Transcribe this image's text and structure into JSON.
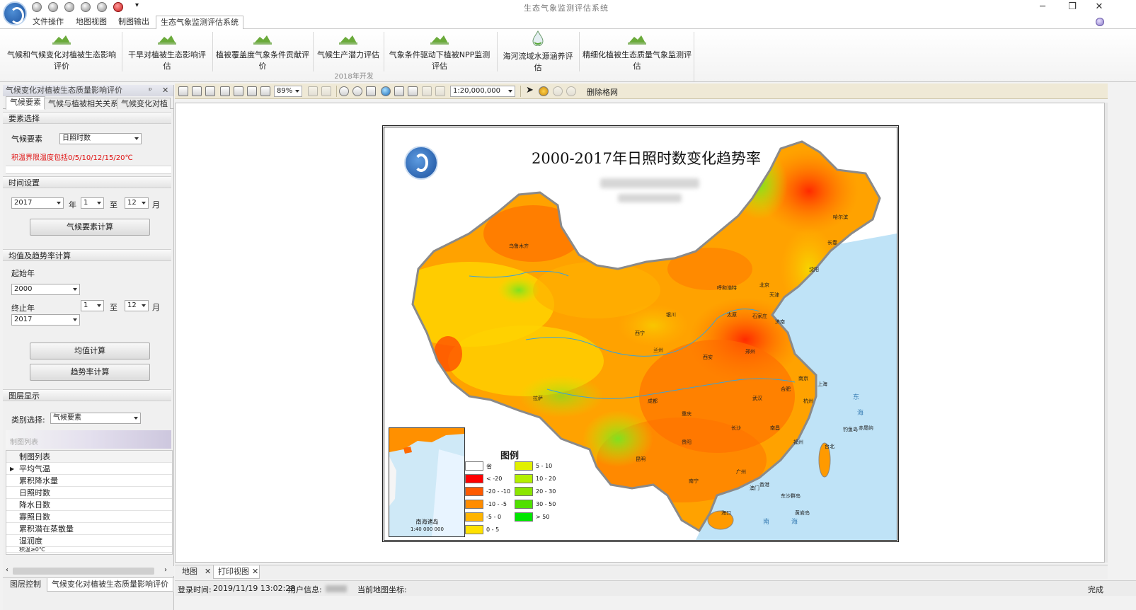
{
  "window": {
    "title": "生态气象监测评估系统",
    "minimize_symbol": "─",
    "maximize_symbol": "❐",
    "close_symbol": "✕"
  },
  "ribbon_tabs": [
    "文件操作",
    "地图视图",
    "制图输出",
    "生态气象监测评估系统"
  ],
  "ribbon_buttons": [
    "气候和气候变化对植被生态影响评价",
    "干旱对植被生态影响评估",
    "植被覆盖度气象条件贡献评价",
    "气候生产潜力评估",
    "气象条件驱动下植被NPP监测评估",
    "海河流域水源涵养评估",
    "精细化植被生态质量气象监测评估"
  ],
  "ribbon_group_label": "2018年开发",
  "left_panel": {
    "title": "气候变化对植被生态质量影响评价",
    "pin_symbol": "ᵖ",
    "close_symbol": "✕",
    "tabs": [
      "气候要素",
      "气候与植被相关关系",
      "气候变化对植"
    ],
    "element_select": {
      "section": "要素选择",
      "label": "气候要素",
      "value": "日照时数",
      "note": "积温界限温度包括0/5/10/12/15/20℃"
    },
    "time_settings": {
      "section": "时间设置",
      "year": "2017",
      "year_unit": "年",
      "month_start": "1",
      "to": "至",
      "month_end": "12",
      "month_unit": "月",
      "calc_button": "气候要素计算"
    },
    "mean_trend": {
      "section": "均值及趋势率计算",
      "start_label": "起始年",
      "start_year": "2000",
      "end_label": "终止年",
      "month_start": "1",
      "to": "至",
      "month_end": "12",
      "month_unit": "月",
      "end_year": "2017",
      "mean_button": "均值计算",
      "trend_button": "趋势率计算"
    },
    "layer_display": {
      "section": "图层显示",
      "category_label": "类别选择:",
      "category_value": "气候要素",
      "list_caption": "制图列表",
      "list_header": "制图列表",
      "items": [
        "平均气温",
        "累积降水量",
        "日照时数",
        "降水日数",
        "寡照日数",
        "累积潜在蒸散量",
        "湿润度",
        "积温≥0℃"
      ]
    },
    "bottom_tabs": [
      "图层控制",
      "气候变化对植被生态质量影响评价"
    ]
  },
  "map_toolbar": {
    "zoom_value": "89%",
    "scale_value": "1:20,000,000",
    "delete_grid_label": "删除格网"
  },
  "map": {
    "title": "2000-2017年日照时数变化趋势率",
    "legend_title": "图例",
    "legend_items": [
      {
        "label": "省",
        "color": "#ffffff"
      },
      {
        "label": "< -20",
        "color": "#ff0000"
      },
      {
        "label": "-20 - -10",
        "color": "#ff5a00"
      },
      {
        "label": "-10 - -5",
        "color": "#ff8c00"
      },
      {
        "label": "-5 - 0",
        "color": "#ffb400"
      },
      {
        "label": "0 - 5",
        "color": "#ffe100"
      },
      {
        "label": "5 - 10",
        "color": "#e1f000"
      },
      {
        "label": "10 - 20",
        "color": "#b4f000"
      },
      {
        "label": "20 - 30",
        "color": "#8ce600"
      },
      {
        "label": "30 - 50",
        "color": "#50e000"
      },
      {
        "label": "> 50",
        "color": "#00e600"
      }
    ],
    "inset_label": "南海诸岛",
    "inset_scale": "1:40 000 000",
    "sea_labels": [
      "东",
      "海",
      "南",
      "海"
    ],
    "place_labels": [
      "乌鲁木齐",
      "拉萨",
      "西宁",
      "兰州",
      "银川",
      "呼和浩特",
      "北京",
      "天津",
      "石家庄",
      "太原",
      "济南",
      "郑州",
      "西安",
      "成都",
      "重庆",
      "贵阳",
      "昆明",
      "南宁",
      "广州",
      "长沙",
      "武汉",
      "南昌",
      "合肥",
      "南京",
      "上海",
      "杭州",
      "福州",
      "台北",
      "沈阳",
      "长春",
      "哈尔滨",
      "海口",
      "香港",
      "澳门",
      "钓鱼岛",
      "赤尾屿",
      "东沙群岛",
      "黄岩岛"
    ]
  },
  "doc_tabs": [
    "地图",
    "打印视图"
  ],
  "status": {
    "login_label": "登录时间:",
    "login_time": "2019/11/19 13:02:28",
    "user_label": "用户信息:",
    "coord_label": "当前地图坐标:",
    "state": "完成"
  }
}
